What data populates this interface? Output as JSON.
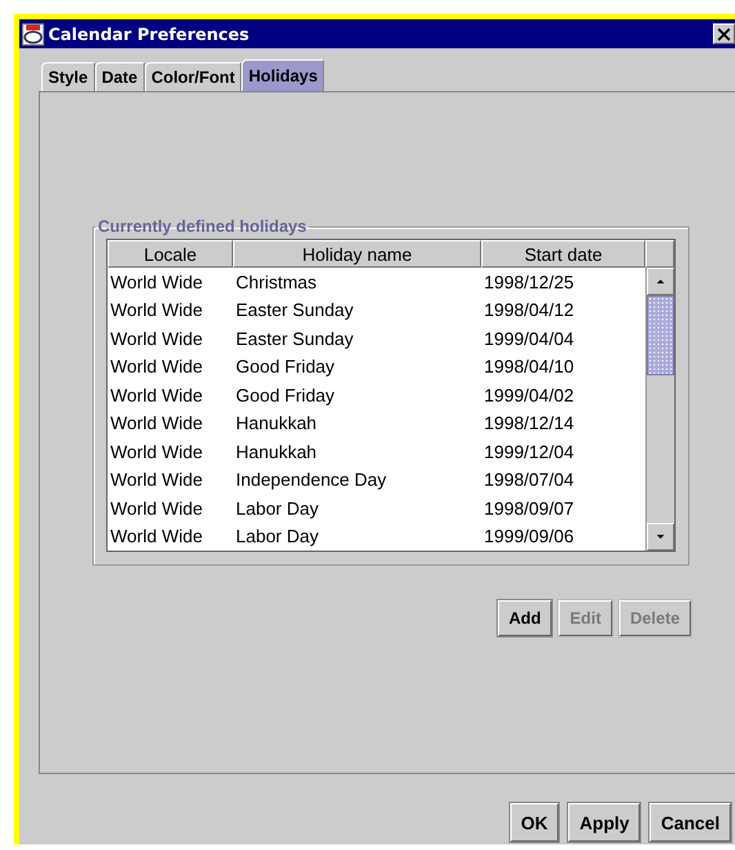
{
  "window": {
    "title": "Calendar Preferences"
  },
  "tabs": [
    {
      "label": "Style",
      "selected": false
    },
    {
      "label": "Date",
      "selected": false
    },
    {
      "label": "Color/Font",
      "selected": false
    },
    {
      "label": "Holidays",
      "selected": true
    }
  ],
  "group": {
    "title": "Currently defined holidays"
  },
  "table": {
    "columns": [
      "Locale",
      "Holiday name",
      "Start date"
    ],
    "rows": [
      [
        "World Wide",
        "Christmas",
        "1998/12/25"
      ],
      [
        "World Wide",
        "Easter Sunday",
        "1998/04/12"
      ],
      [
        "World Wide",
        "Easter Sunday",
        "1999/04/04"
      ],
      [
        "World Wide",
        "Good Friday",
        "1998/04/10"
      ],
      [
        "World Wide",
        "Good Friday",
        "1999/04/02"
      ],
      [
        "World Wide",
        "Hanukkah",
        "1998/12/14"
      ],
      [
        "World Wide",
        "Hanukkah",
        "1999/12/04"
      ],
      [
        "World Wide",
        "Independence Day",
        "1998/07/04"
      ],
      [
        "World Wide",
        "Labor Day",
        "1998/09/07"
      ],
      [
        "World Wide",
        "Labor Day",
        "1999/09/06"
      ]
    ]
  },
  "actions": [
    {
      "label": "Add",
      "disabled": false
    },
    {
      "label": "Edit",
      "disabled": true
    },
    {
      "label": "Delete",
      "disabled": true
    }
  ],
  "buttons": [
    {
      "label": "OK"
    },
    {
      "label": "Apply"
    },
    {
      "label": "Cancel"
    }
  ]
}
